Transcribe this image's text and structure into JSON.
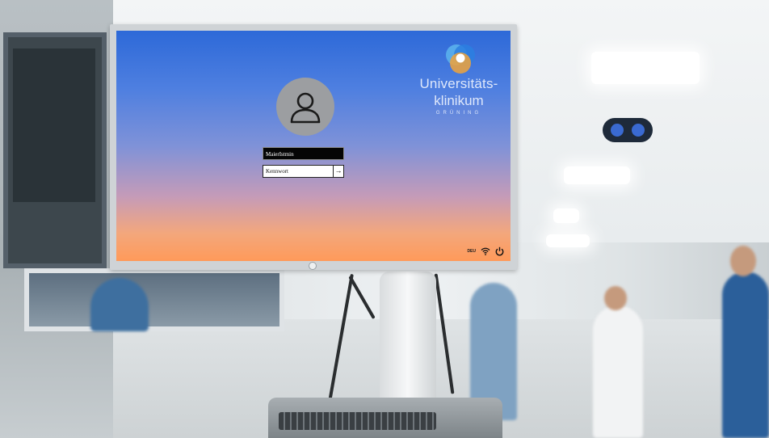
{
  "login": {
    "username_value": "MaierIstmin",
    "password_placeholder": "Kennwort",
    "submit_glyph": "→"
  },
  "brand": {
    "line1": "Universitäts-",
    "line2": "klinikum",
    "line3": "GRÜNING"
  },
  "tray": {
    "language": "DEU",
    "wifi_icon": "wifi-icon",
    "power_icon": "power-icon"
  },
  "colors": {
    "screen_top": "#2d69d8",
    "screen_bottom": "#ff9a5a",
    "avatar_bg": "#9c9ea1",
    "logo_blue": "#2b7fe0",
    "logo_orange": "#f0a33a"
  }
}
